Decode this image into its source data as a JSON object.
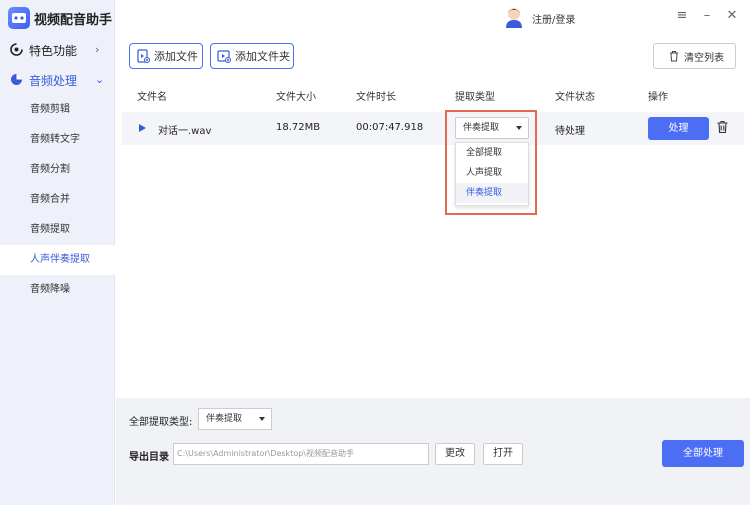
{
  "app": {
    "title": "视频配音助手",
    "login_label": "注册/登录"
  },
  "sidebar": {
    "groups": [
      {
        "label": "特色功能",
        "expanded": false
      },
      {
        "label": "音频处理",
        "expanded": true
      }
    ],
    "items": [
      {
        "label": "音频剪辑"
      },
      {
        "label": "音频转文字"
      },
      {
        "label": "音频分割"
      },
      {
        "label": "音频合并"
      },
      {
        "label": "音频提取"
      },
      {
        "label": "人声伴奏提取",
        "selected": true
      },
      {
        "label": "音频降噪"
      }
    ]
  },
  "toolbar": {
    "add_file": "添加文件",
    "add_folder": "添加文件夹",
    "clear_list": "清空列表"
  },
  "table": {
    "headers": [
      "文件名",
      "文件大小",
      "文件时长",
      "提取类型",
      "文件状态",
      "操作"
    ],
    "rows": [
      {
        "filename": "对话一.wav",
        "size": "18.72MB",
        "duration": "00:07:47.918",
        "type": "伴奏提取",
        "status": "待处理",
        "action": "处理"
      }
    ]
  },
  "dropdown": {
    "options": [
      "全部提取",
      "人声提取",
      "伴奏提取"
    ],
    "selected": "伴奏提取"
  },
  "bottom": {
    "all_type_label": "全部提取类型:",
    "all_type_value": "伴奏提取",
    "export_label": "导出目录",
    "export_path": "C:\\Users\\Administrator\\Desktop\\视频配音助手",
    "change_button": "更改",
    "open_button": "打开",
    "process_all_button": "全部处理"
  },
  "colors": {
    "accent": "#4c6ef5",
    "highlight": "#e06b4f",
    "sidebar_bg": "#eef1fa"
  }
}
